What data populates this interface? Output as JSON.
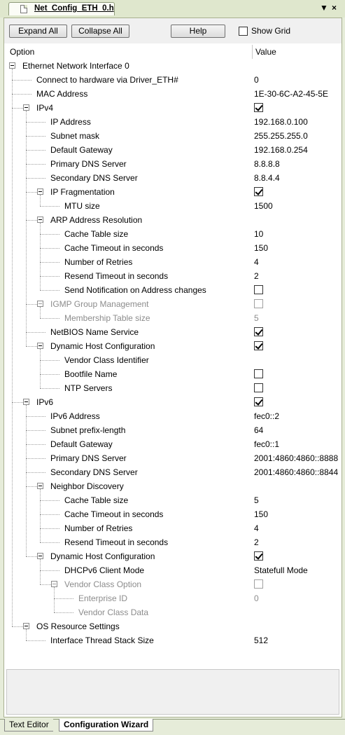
{
  "document_tab": {
    "title": "Net_Config_ETH_0.h"
  },
  "toolbar": {
    "expand_all": "Expand All",
    "collapse_all": "Collapse All",
    "help": "Help",
    "show_grid": "Show Grid",
    "show_grid_checked": false
  },
  "columns": {
    "option": "Option",
    "value": "Value"
  },
  "tree": [
    {
      "level": 0,
      "expander": true,
      "label": "Ethernet Network Interface 0"
    },
    {
      "level": 1,
      "label": "Connect to hardware via Driver_ETH#",
      "value": "0"
    },
    {
      "level": 1,
      "label": "MAC Address",
      "value": "1E-30-6C-A2-45-5E"
    },
    {
      "level": 1,
      "expander": true,
      "label": "IPv4",
      "checkbox": true,
      "checked": true
    },
    {
      "level": 2,
      "label": "IP Address",
      "value": "192.168.0.100"
    },
    {
      "level": 2,
      "label": "Subnet mask",
      "value": "255.255.255.0"
    },
    {
      "level": 2,
      "label": "Default Gateway",
      "value": "192.168.0.254"
    },
    {
      "level": 2,
      "label": "Primary DNS Server",
      "value": "8.8.8.8"
    },
    {
      "level": 2,
      "label": "Secondary DNS Server",
      "value": "8.8.4.4"
    },
    {
      "level": 2,
      "expander": true,
      "label": "IP Fragmentation",
      "checkbox": true,
      "checked": true
    },
    {
      "level": 3,
      "label": "MTU size",
      "value": "1500"
    },
    {
      "level": 2,
      "expander": true,
      "label": "ARP Address Resolution"
    },
    {
      "level": 3,
      "label": "Cache Table size",
      "value": "10"
    },
    {
      "level": 3,
      "label": "Cache Timeout in seconds",
      "value": "150"
    },
    {
      "level": 3,
      "label": "Number of Retries",
      "value": "4"
    },
    {
      "level": 3,
      "label": "Resend Timeout in seconds",
      "value": "2"
    },
    {
      "level": 3,
      "label": "Send Notification on Address changes",
      "checkbox": true,
      "checked": false
    },
    {
      "level": 2,
      "expander": true,
      "label": "IGMP Group Management",
      "checkbox": true,
      "checked": false,
      "disabled": true
    },
    {
      "level": 3,
      "label": "Membership Table size",
      "value": "5",
      "disabled": true
    },
    {
      "level": 2,
      "label": "NetBIOS Name Service",
      "checkbox": true,
      "checked": true
    },
    {
      "level": 2,
      "expander": true,
      "label": "Dynamic Host Configuration",
      "checkbox": true,
      "checked": true
    },
    {
      "level": 3,
      "label": "Vendor Class Identifier",
      "value": ""
    },
    {
      "level": 3,
      "label": "Bootfile Name",
      "checkbox": true,
      "checked": false
    },
    {
      "level": 3,
      "label": "NTP Servers",
      "checkbox": true,
      "checked": false
    },
    {
      "level": 1,
      "expander": true,
      "label": "IPv6",
      "checkbox": true,
      "checked": true
    },
    {
      "level": 2,
      "label": "IPv6 Address",
      "value": "fec0::2"
    },
    {
      "level": 2,
      "label": "Subnet prefix-length",
      "value": "64"
    },
    {
      "level": 2,
      "label": "Default Gateway",
      "value": "fec0::1"
    },
    {
      "level": 2,
      "label": "Primary DNS Server",
      "value": "2001:4860:4860::8888"
    },
    {
      "level": 2,
      "label": "Secondary DNS Server",
      "value": "2001:4860:4860::8844"
    },
    {
      "level": 2,
      "expander": true,
      "label": "Neighbor Discovery"
    },
    {
      "level": 3,
      "label": "Cache Table size",
      "value": "5"
    },
    {
      "level": 3,
      "label": "Cache Timeout in seconds",
      "value": "150"
    },
    {
      "level": 3,
      "label": "Number of Retries",
      "value": "4"
    },
    {
      "level": 3,
      "label": "Resend Timeout in seconds",
      "value": "2"
    },
    {
      "level": 2,
      "expander": true,
      "label": "Dynamic Host Configuration",
      "checkbox": true,
      "checked": true
    },
    {
      "level": 3,
      "label": "DHCPv6 Client Mode",
      "value": "Statefull Mode"
    },
    {
      "level": 3,
      "expander": true,
      "label": "Vendor Class Option",
      "checkbox": true,
      "checked": false,
      "disabled": true
    },
    {
      "level": 4,
      "label": "Enterprise ID",
      "value": "0",
      "disabled": true
    },
    {
      "level": 4,
      "label": "Vendor Class Data",
      "value": "",
      "disabled": true
    },
    {
      "level": 1,
      "expander": true,
      "label": "OS Resource Settings"
    },
    {
      "level": 2,
      "label": "Interface Thread Stack Size",
      "value": "512"
    }
  ],
  "bottom_tabs": {
    "text_editor": "Text Editor",
    "configuration_wizard": "Configuration Wizard"
  }
}
